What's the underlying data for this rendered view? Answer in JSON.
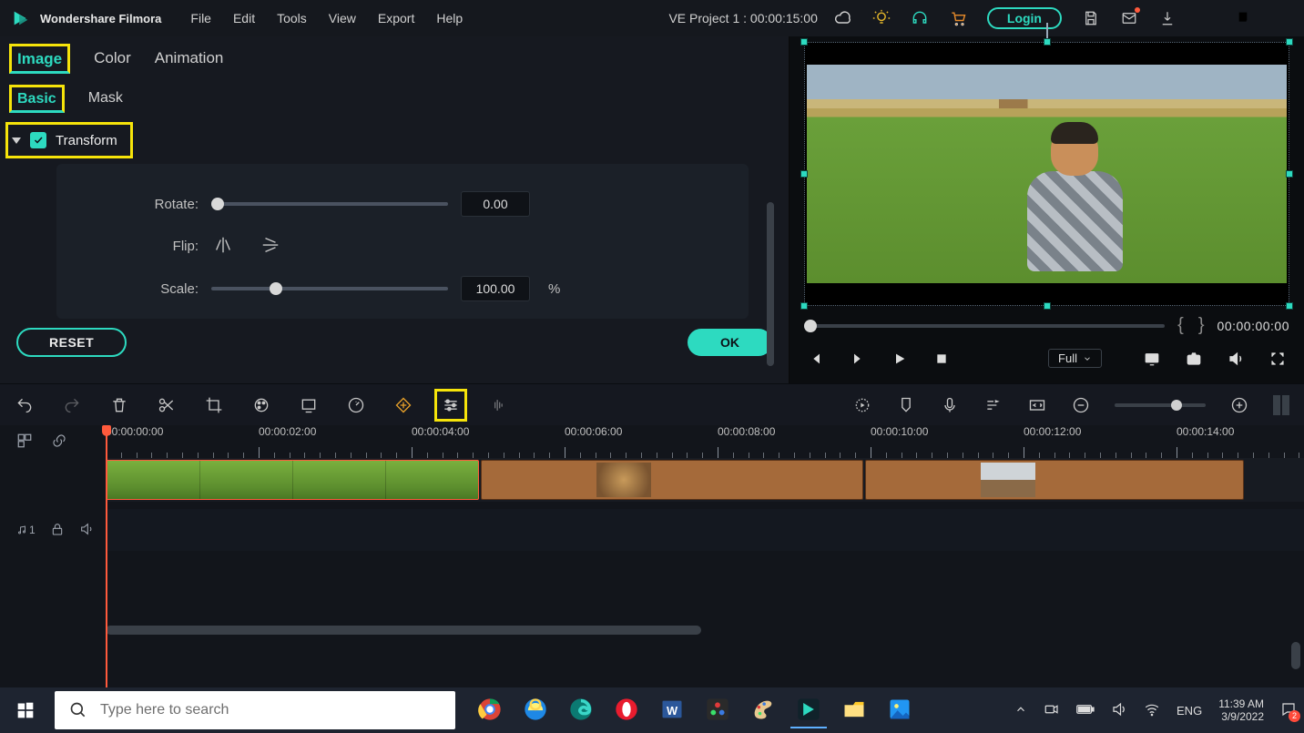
{
  "app": {
    "title": "Wondershare Filmora"
  },
  "menu": {
    "file": "File",
    "edit": "Edit",
    "tools": "Tools",
    "view": "View",
    "export": "Export",
    "help": "Help"
  },
  "project": {
    "label": "VE Project 1 : 00:00:15:00"
  },
  "header": {
    "login": "Login"
  },
  "tabs": {
    "image": "Image",
    "color": "Color",
    "animation": "Animation"
  },
  "subtabs": {
    "basic": "Basic",
    "mask": "Mask"
  },
  "accordion": {
    "transform": "Transform"
  },
  "props": {
    "rotate_label": "Rotate:",
    "rotate_value": "0.00",
    "flip_label": "Flip:",
    "scale_label": "Scale:",
    "scale_value": "100.00",
    "percent": "%"
  },
  "buttons": {
    "reset": "RESET",
    "ok": "OK"
  },
  "preview": {
    "timecode": "00:00:00:00",
    "full": "Full"
  },
  "timeline": {
    "marks": [
      "00:00:00:00",
      "00:00:02:00",
      "00:00:04:00",
      "00:00:06:00",
      "00:00:08:00",
      "00:00:10:00",
      "00:00:12:00",
      "00:00:14:00"
    ],
    "audio_label": "1"
  },
  "taskbar": {
    "search_placeholder": "Type here to search",
    "lang": "ENG",
    "time": "11:39 AM",
    "date": "3/9/2022",
    "notif_count": "2"
  }
}
